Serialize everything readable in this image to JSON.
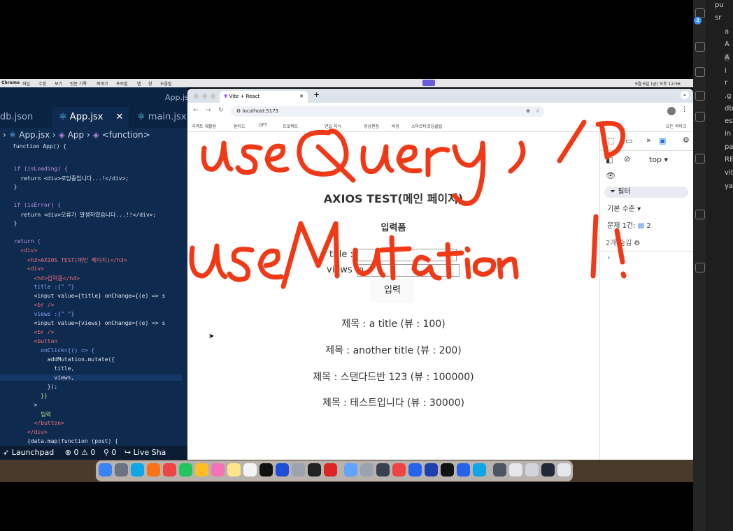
{
  "menubar": {
    "app": "Chrome",
    "items": [
      "파일",
      "수정",
      "보기",
      "방문 기록",
      "북마크",
      "프로필",
      "탭",
      "창",
      "도움말"
    ],
    "clock": "9월 6일 (금) 오후 12:56"
  },
  "editor": {
    "window_title": "App.js",
    "tabs": [
      "db.json",
      "App.jsx",
      "main.jsx"
    ],
    "breadcrumb": [
      "App.jsx",
      "App",
      "<function>"
    ],
    "code_lines": [
      "function App() {",
      "  if (isLoading) {",
      "    return <div>로딩중입니다...!</div>;",
      "  }",
      "  if (isError) {",
      "    return <div>오류가 발생하였습니다...!!</div>;",
      "  }",
      "  return (",
      "    <div>",
      "      <h3>AXIOS TEST(메인 페이지)</h3>",
      "      <div>",
      "        <h4>입력폼</h4>",
      "        title :{\" \"}",
      "        <input value={title} onChange={(e) => s",
      "        <br />",
      "        views :{\" \"}",
      "        <input value={views} onChange={(e) => s",
      "        <br />",
      "        <button",
      "          onClick={() => {",
      "            addMutation.mutate({",
      "              title,",
      "              views,",
      "            });",
      "          }}",
      "        >",
      "          입력",
      "        </button>",
      "      </div>",
      "      {data.map(function (post) {"
    ],
    "status": {
      "launchpad": "Launchpad",
      "problems": "0",
      "warnings": "0",
      "ports": "0",
      "live_share": "Live Sha"
    }
  },
  "browser": {
    "tab_title": "Vite + React",
    "url": "localhost:5173",
    "bookmarks": [
      "리액트 재활용",
      "원티드",
      "GPT",
      "프로젝트",
      "연습 지식",
      "영상편집",
      "비용",
      "스파르타코딩클럽"
    ],
    "all_bookmarks": "모든 북마크"
  },
  "page": {
    "heading": "AXIOS TEST(메인 페이지)",
    "subheading": "입력폼",
    "title_label": "title :",
    "title_value": "",
    "views_label": "views :",
    "views_value": "0",
    "submit_label": "입력",
    "posts": [
      "제목 : a title (뷰 : 100)",
      "제목 : another title (뷰 : 200)",
      "제목 : 스탠다드반 123 (뷰 : 100000)",
      "제목 : 테스트입니다 (뷰 : 30000)"
    ]
  },
  "devtools": {
    "context": "top",
    "filter": "필터",
    "level": "기본 수준",
    "issues_label": "문제 1건:",
    "issues_count": "2",
    "hidden": "2개 숨김"
  },
  "file_tree": [
    "pu",
    "sr",
    "a",
    "A",
    "A",
    "i",
    "r",
    ".g",
    "db",
    "es",
    "in",
    "pa",
    "RE",
    "vit",
    "ya"
  ],
  "annotation": {
    "line1": "useQuery / D",
    "line2": "useMutation !!"
  },
  "colors": {
    "ink": "#f03a17",
    "editor_bg": "#0e2a4f",
    "accent": "#3794ff"
  }
}
